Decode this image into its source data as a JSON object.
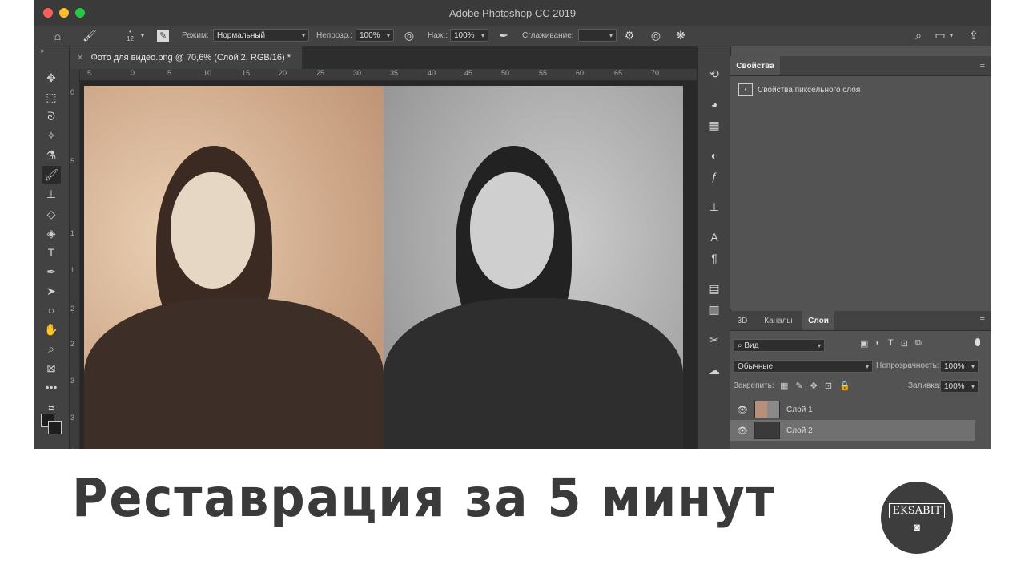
{
  "window": {
    "title": "Adobe Photoshop CC 2019"
  },
  "options_bar": {
    "home_icon": "home-icon",
    "brush_icon": "brush-icon",
    "brush_size": "12",
    "mode_label": "Режим:",
    "mode_value": "Нормальный",
    "opacity_label": "Непрозр.:",
    "opacity_value": "100%",
    "pressure_label": "Наж.:",
    "pressure_value": "100%",
    "smoothing_label": "Сглаживание:",
    "smoothing_value": ""
  },
  "document_tab": {
    "title": "Фото для видео.png @ 70,6% (Слой 2, RGB/16) *",
    "close_glyph": "×"
  },
  "ruler": {
    "h_ticks": [
      "5",
      "0",
      "5",
      "10",
      "15",
      "20",
      "25",
      "30",
      "35",
      "40",
      "45",
      "50",
      "55",
      "60",
      "65",
      "70"
    ],
    "v_ticks": [
      "0",
      "5",
      "1",
      "1",
      "2",
      "2",
      "3",
      "3",
      "4"
    ]
  },
  "properties_panel": {
    "tab": "Свойства",
    "item": "Свойства пиксельного слоя"
  },
  "layers_panel": {
    "tabs": [
      "3D",
      "Каналы",
      "Слои"
    ],
    "filter_value": "Вид",
    "blend_mode": "Обычные",
    "opacity_label": "Непрозрачность:",
    "opacity_value": "100%",
    "lock_label": "Закрепить:",
    "fill_label": "Заливка:",
    "fill_value": "100%",
    "layers": [
      {
        "name": "Слой 1",
        "selected": false
      },
      {
        "name": "Слой 2",
        "selected": true
      }
    ]
  },
  "overlay": {
    "headline": "Реставрация за 5 минут",
    "logo_text": "EKSABIT"
  },
  "colors": {
    "ui_dark": "#535353",
    "ui_panel": "#424242",
    "headline": "#3a3a3a",
    "sepia": "#cfa88a",
    "bw": "#a6a6a6"
  }
}
